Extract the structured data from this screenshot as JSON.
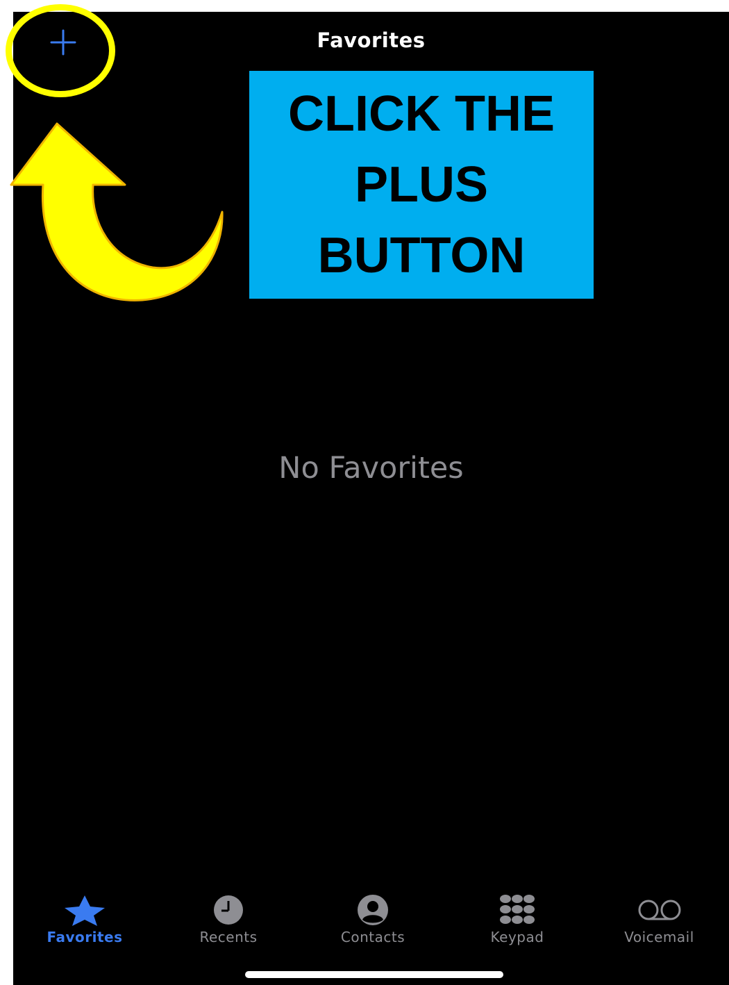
{
  "header": {
    "title": "Favorites",
    "add_icon": "plus-icon"
  },
  "main": {
    "empty_message": "No Favorites"
  },
  "tabbar": {
    "tabs": [
      {
        "label": "Favorites",
        "icon": "star-icon",
        "active": true
      },
      {
        "label": "Recents",
        "icon": "clock-icon",
        "active": false
      },
      {
        "label": "Contacts",
        "icon": "person-circle-icon",
        "active": false
      },
      {
        "label": "Keypad",
        "icon": "keypad-icon",
        "active": false
      },
      {
        "label": "Voicemail",
        "icon": "voicemail-icon",
        "active": false
      }
    ]
  },
  "annotation": {
    "callout_text": "CLICK THE PLUS BUTTON",
    "highlight_color": "#ffff00",
    "callout_bg": "#00aeef"
  },
  "colors": {
    "accent": "#3a7bf0",
    "inactive": "#8e8e93",
    "background": "#000000"
  }
}
